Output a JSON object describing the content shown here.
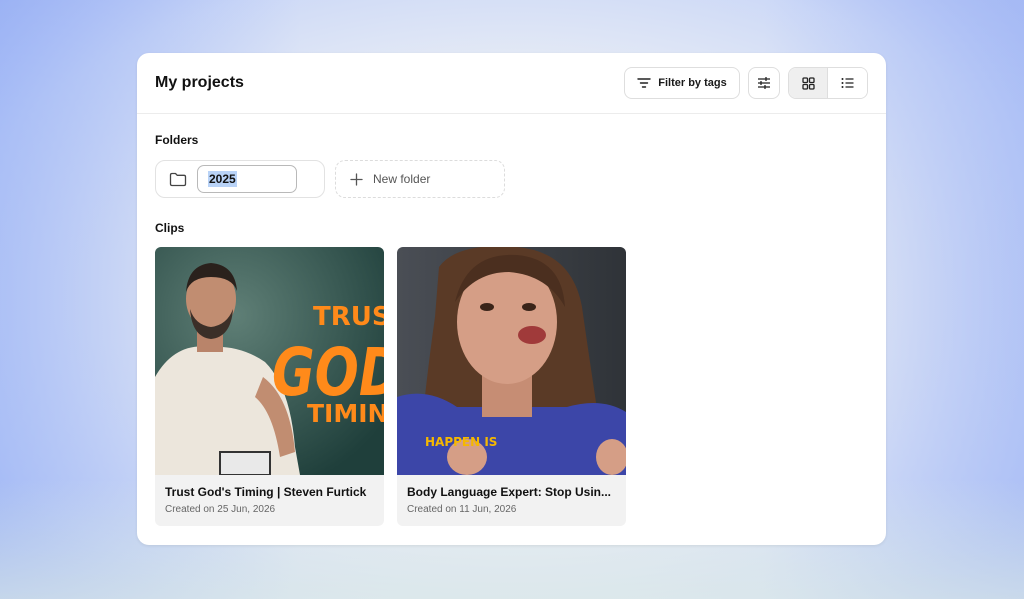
{
  "header": {
    "title": "My projects",
    "filter_label": "Filter by tags"
  },
  "folders": {
    "heading": "Folders",
    "items": [
      {
        "name": "2025"
      }
    ],
    "new_folder_label": "New folder"
  },
  "clips": {
    "heading": "Clips",
    "items": [
      {
        "title": "Trust God's Timing | Steven Furtick",
        "created": "Created on 25 Jun, 2026",
        "thumb_text": [
          "TRUS",
          "GOD",
          "TIMIN"
        ]
      },
      {
        "title": "Body Language Expert: Stop Usin...",
        "created": "Created on 11 Jun, 2026",
        "thumb_text": [
          "HAPPEN IS"
        ]
      }
    ]
  },
  "colors": {
    "accent_orange": "#ff8a1a",
    "caption_yellow": "#f5b800",
    "panel_bg": "#ffffff"
  }
}
